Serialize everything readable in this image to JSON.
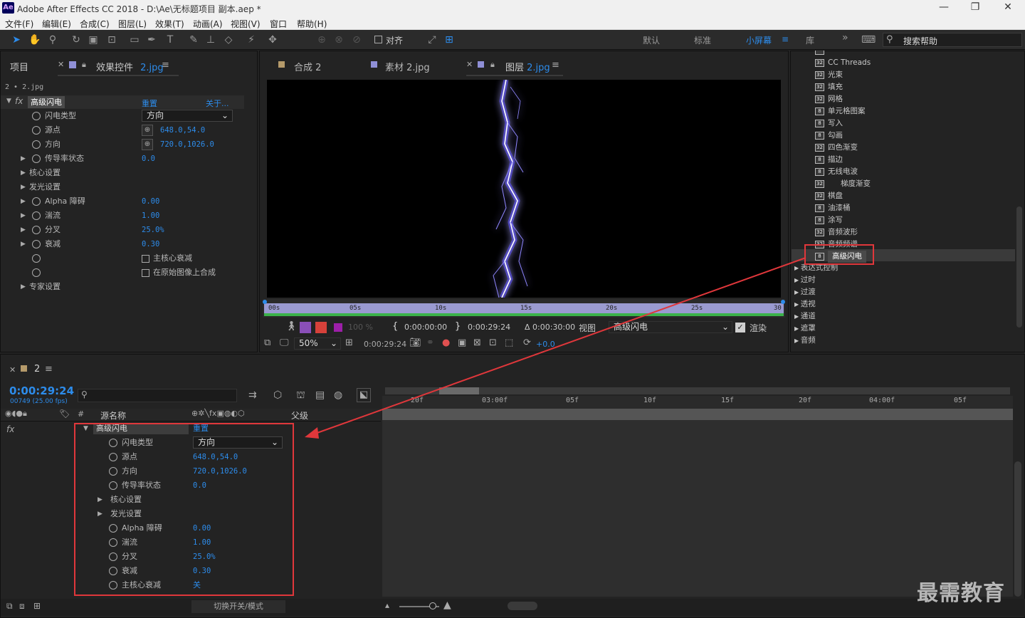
{
  "window": {
    "title": "Adobe After Effects CC 2018 - D:\\Ae\\无标题项目 副本.aep *",
    "logo": "Ae",
    "minimize": "—",
    "restore": "❐",
    "close": "✕"
  },
  "menu": [
    "文件(F)",
    "编辑(E)",
    "合成(C)",
    "图层(L)",
    "效果(T)",
    "动画(A)",
    "视图(V)",
    "窗口",
    "帮助(H)"
  ],
  "toolbar": {
    "align_label": "对齐",
    "workspaces": [
      "默认",
      "标准",
      "小屏幕",
      "库"
    ],
    "active_workspace": "小屏幕",
    "more": "»",
    "search_placeholder": "搜索帮助"
  },
  "effects_panel": {
    "tab_project": "项目",
    "tab_label": "效果控件",
    "tab_file": "2.jpg",
    "breadcrumb": "2 • 2.jpg",
    "effect_name": "高级闪电",
    "reset": "重置",
    "about": "关于...",
    "props": [
      {
        "label": "闪电类型",
        "value": "方向",
        "kind": "dropdown"
      },
      {
        "label": "源点",
        "value": "648.0,54.0",
        "kind": "point"
      },
      {
        "label": "方向",
        "value": "720.0,1026.0",
        "kind": "point"
      },
      {
        "label": "传导率状态",
        "value": "0.0",
        "kind": "twirl"
      },
      {
        "label": "核心设置",
        "value": "",
        "kind": "group"
      },
      {
        "label": "发光设置",
        "value": "",
        "kind": "group"
      },
      {
        "label": "Alpha 障碍",
        "value": "0.00",
        "kind": "twirl"
      },
      {
        "label": "湍流",
        "value": "1.00",
        "kind": "twirl"
      },
      {
        "label": "分叉",
        "value": "25.0%",
        "kind": "twirl"
      },
      {
        "label": "衰减",
        "value": "0.30",
        "kind": "twirl"
      },
      {
        "label": "主核心衰减",
        "value": "",
        "kind": "check"
      },
      {
        "label": "在原始图像上合成",
        "value": "",
        "kind": "check"
      },
      {
        "label": "专家设置",
        "value": "",
        "kind": "group"
      }
    ]
  },
  "viewer": {
    "tabs": [
      {
        "label": "合成",
        "file": "2"
      },
      {
        "label": "素材",
        "file": "2.jpg"
      },
      {
        "label": "图层",
        "file": "2.jpg"
      }
    ],
    "ruler_ticks": [
      "00s",
      "05s",
      "10s",
      "15s",
      "20s",
      "25s",
      "30"
    ],
    "opacity": "100 %",
    "time_in": "0:00:00:00",
    "time_out": "0:00:29:24",
    "duration": "Δ 0:00:30:00",
    "view_label": "视图",
    "view_value": "高级闪电",
    "render_label": "渲染",
    "zoom": "50%",
    "current_time": "0:00:29:24",
    "exposure": "+0.0"
  },
  "effects_list": {
    "items": [
      {
        "label": "CC Threads",
        "badge": "32"
      },
      {
        "label": "光束",
        "badge": "32"
      },
      {
        "label": "填充",
        "badge": "32"
      },
      {
        "label": "网格",
        "badge": "32"
      },
      {
        "label": "单元格图案",
        "badge": "8"
      },
      {
        "label": "写入",
        "badge": "8"
      },
      {
        "label": "勾画",
        "badge": "8"
      },
      {
        "label": "四色渐变",
        "badge": "32"
      },
      {
        "label": "描边",
        "badge": "8"
      },
      {
        "label": "无线电波",
        "badge": "8"
      },
      {
        "label": "梯度渐变",
        "badge": "32"
      },
      {
        "label": "棋盘",
        "badge": "32"
      },
      {
        "label": "油漆桶",
        "badge": "8"
      },
      {
        "label": "涂写",
        "badge": "8"
      },
      {
        "label": "音频波形",
        "badge": "32"
      },
      {
        "label": "音频频谱",
        "badge": "32"
      },
      {
        "label": "高级闪电",
        "badge": "8"
      }
    ],
    "selected": "高级闪电",
    "categories": [
      "表达式控制",
      "过时",
      "过渡",
      "透视",
      "通道",
      "遮罩",
      "音频"
    ]
  },
  "timeline": {
    "comp_name": "2",
    "timecode": "0:00:29:24",
    "frames": "00749 (25.00 fps)",
    "col_source": "源名称",
    "col_parent": "父级",
    "ruler_ticks": [
      "20f",
      "03:00f",
      "05f",
      "10f",
      "15f",
      "20f",
      "04:00f",
      "05f"
    ],
    "effect_name": "高级闪电",
    "reset": "重置",
    "props": [
      {
        "label": "闪电类型",
        "value": "方向",
        "kind": "dropdown"
      },
      {
        "label": "源点",
        "value": "648.0,54.0",
        "kind": "value"
      },
      {
        "label": "方向",
        "value": "720.0,1026.0",
        "kind": "value"
      },
      {
        "label": "传导率状态",
        "value": "0.0",
        "kind": "value"
      },
      {
        "label": "核心设置",
        "value": "",
        "kind": "group"
      },
      {
        "label": "发光设置",
        "value": "",
        "kind": "group"
      },
      {
        "label": "Alpha 障碍",
        "value": "0.00",
        "kind": "value"
      },
      {
        "label": "湍流",
        "value": "1.00",
        "kind": "value"
      },
      {
        "label": "分叉",
        "value": "25.0%",
        "kind": "value"
      },
      {
        "label": "衰减",
        "value": "0.30",
        "kind": "value"
      },
      {
        "label": "主核心衰减",
        "value": "关",
        "kind": "value"
      }
    ],
    "toggle_label": "切换开关/模式"
  },
  "watermark": "最需教育",
  "colors": {
    "accent": "#2d8ceb",
    "highlight": "#e0373b",
    "lightning": "#6f63ff"
  }
}
